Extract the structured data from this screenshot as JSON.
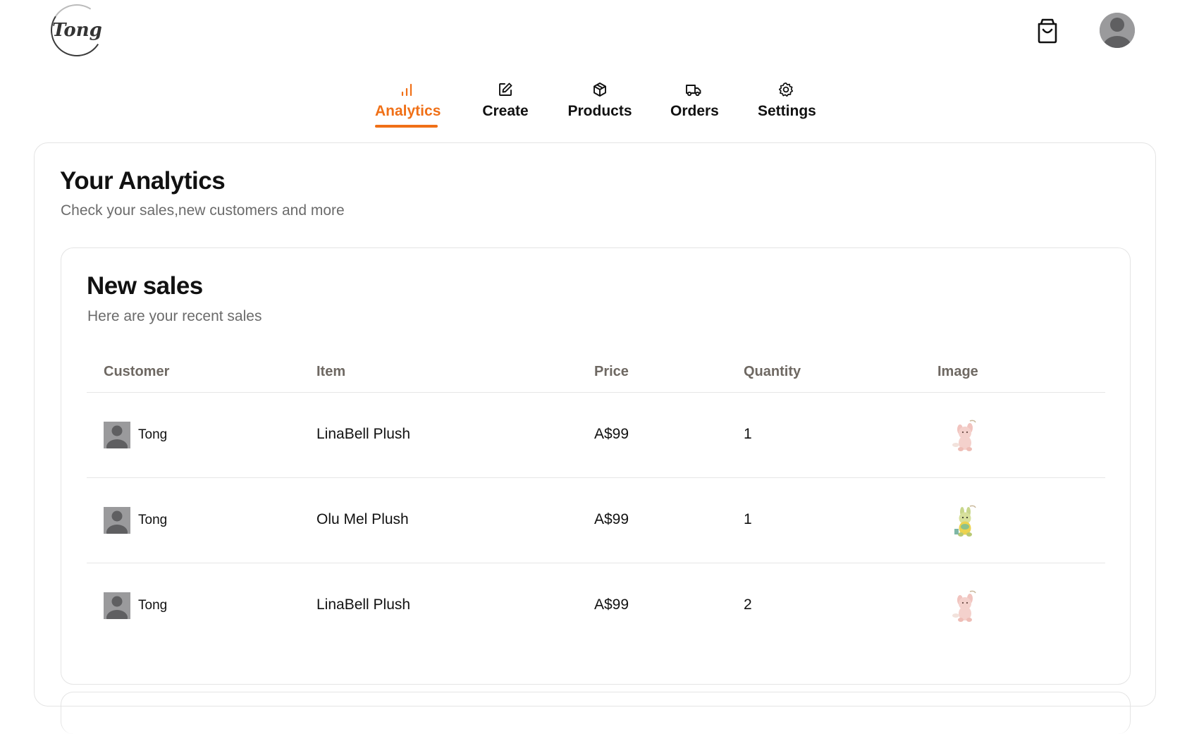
{
  "brand": {
    "logo_text": "Tong"
  },
  "header": {
    "cart_icon": "shopping-bag-icon",
    "avatar_icon": "user-avatar-icon"
  },
  "nav": {
    "tabs": [
      {
        "label": "Analytics",
        "icon": "bar-chart-icon",
        "active": true
      },
      {
        "label": "Create",
        "icon": "edit-icon",
        "active": false
      },
      {
        "label": "Products",
        "icon": "package-icon",
        "active": false
      },
      {
        "label": "Orders",
        "icon": "truck-icon",
        "active": false
      },
      {
        "label": "Settings",
        "icon": "gear-icon",
        "active": false
      }
    ]
  },
  "page": {
    "title": "Your Analytics",
    "subtitle": "Check your sales,new customers and more"
  },
  "sales": {
    "title": "New sales",
    "subtitle": "Here are your recent sales",
    "columns": [
      "Customer",
      "Item",
      "Price",
      "Quantity",
      "Image"
    ],
    "rows": [
      {
        "customer": "Tong",
        "item": "LinaBell Plush",
        "price": "A$99",
        "quantity": "1",
        "image": "linabell-plush-thumbnail"
      },
      {
        "customer": "Tong",
        "item": "Olu Mel Plush",
        "price": "A$99",
        "quantity": "1",
        "image": "olu-mel-plush-thumbnail"
      },
      {
        "customer": "Tong",
        "item": "LinaBell Plush",
        "price": "A$99",
        "quantity": "2",
        "image": "linabell-plush-thumbnail"
      }
    ]
  },
  "colors": {
    "accent": "#f07017",
    "muted_text": "#6b6b6b",
    "border": "#e4e4e4",
    "avatar_gray": "#9a9a9c"
  }
}
